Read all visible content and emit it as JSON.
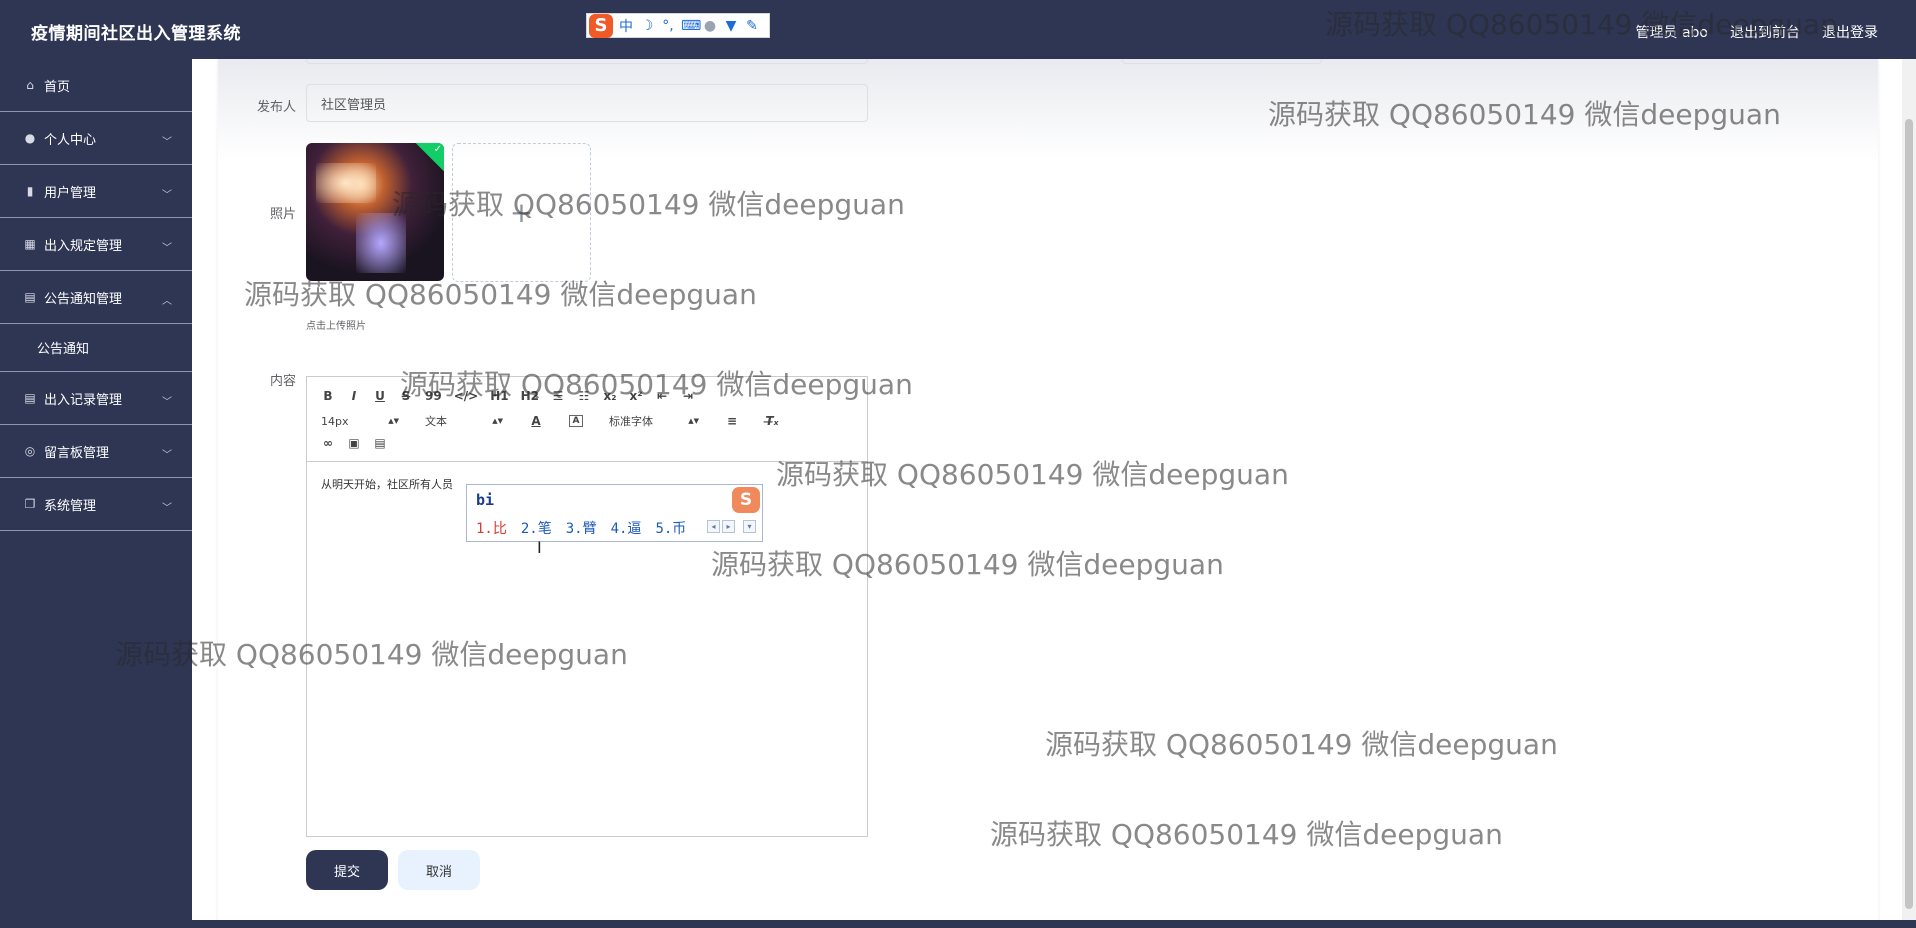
{
  "header": {
    "app_title": "疫情期间社区出入管理系统",
    "admin_label": "管理员 abo",
    "goto_frontend": "退出到前台",
    "logout": "退出登录"
  },
  "ime_toolbar": {
    "logo": "S",
    "mode": "中",
    "items": [
      "moon-icon",
      "punctuation-icon",
      "keyboard-icon",
      "user-icon",
      "skin-icon",
      "wrench-icon"
    ]
  },
  "sidebar": {
    "items": [
      {
        "label": "首页",
        "icon": "home-icon"
      },
      {
        "label": "个人中心",
        "icon": "user-icon"
      },
      {
        "label": "用户管理",
        "icon": "chart-icon"
      },
      {
        "label": "出入规定管理",
        "icon": "grid-icon"
      },
      {
        "label": "公告通知管理",
        "icon": "clipboard-icon"
      },
      {
        "label": "公告通知",
        "icon": ""
      },
      {
        "label": "出入记录管理",
        "icon": "clipboard-icon"
      },
      {
        "label": "留言板管理",
        "icon": "compass-icon"
      },
      {
        "label": "系统管理",
        "icon": "copy-icon"
      }
    ]
  },
  "form": {
    "publisher_label": "发布人",
    "publisher_value": "社区管理员",
    "photo_label": "照片",
    "upload_tip": "点击上传照片",
    "content_label": "内容",
    "submit_label": "提交",
    "cancel_label": "取消"
  },
  "editor": {
    "toolbar_row1": [
      "B",
      "I",
      "U",
      "S",
      "99",
      "</>",
      "H1",
      "H2",
      "ol",
      "ul",
      "x₂",
      "x²",
      "outdent",
      "indent"
    ],
    "font_size": "14px",
    "text_type": "文本",
    "font_family": "标准字体",
    "content_text": "从明天开始，社区所有人员"
  },
  "ime_popup": {
    "pinyin": "bi",
    "candidates": [
      "1.比",
      "2.笔",
      "3.臂",
      "4.逼",
      "5.币"
    ]
  },
  "watermark_text": "源码获取 QQ86050149 微信deepguan"
}
